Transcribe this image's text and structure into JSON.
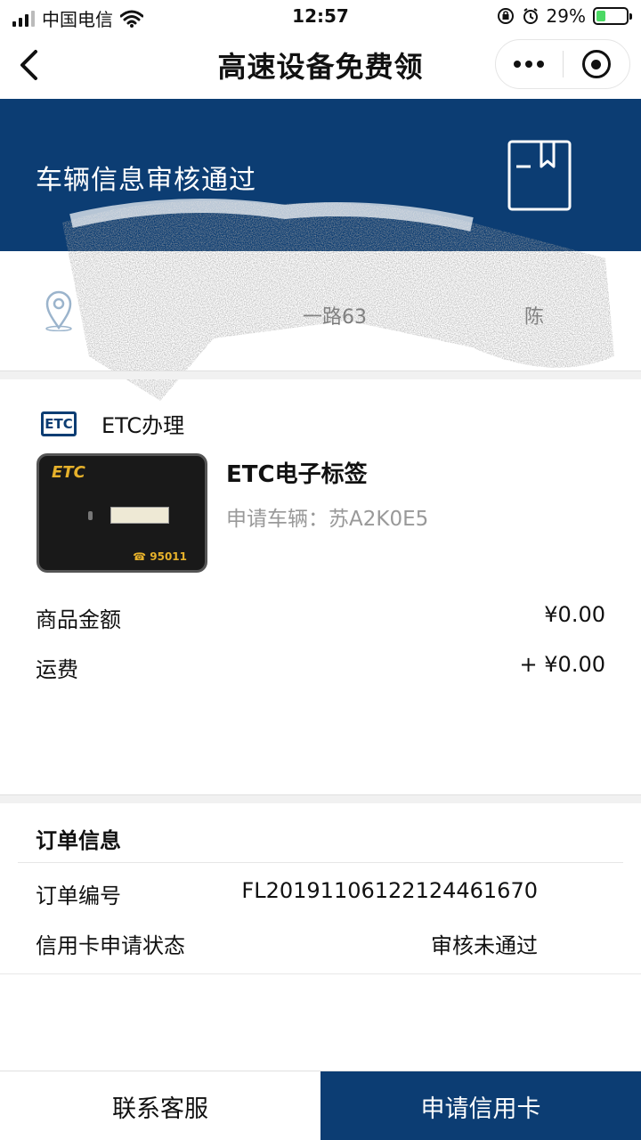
{
  "status_bar": {
    "carrier": "中国电信",
    "time": "12:57",
    "battery": "29%"
  },
  "nav": {
    "title": "高速设备免费领"
  },
  "banner": {
    "text": "车辆信息审核通过"
  },
  "address": {
    "partial_text": "一路63",
    "partial_name": "陈"
  },
  "product": {
    "section_label": "ETC办理",
    "section_badge": "ETC",
    "image_logo": "ETC",
    "image_phone": "☎ 95011",
    "name": "ETC电子标签",
    "vehicle_label": "申请车辆：",
    "vehicle_plate": "苏A2K0E5"
  },
  "prices": {
    "goods_label": "商品金额",
    "goods_value": "¥0.00",
    "shipping_label": "运费",
    "shipping_value": "+ ¥0.00"
  },
  "order": {
    "title": "订单信息",
    "number_label": "订单编号",
    "number_value": "FL2019110612212446167​0",
    "card_status_label": "信用卡申请状态",
    "card_status_value": "审核未通过"
  },
  "bottom": {
    "service_label": "联系客服",
    "apply_label": "申请信用卡"
  },
  "colors": {
    "brand": "#0c3d73",
    "battery": "#4cd964"
  }
}
